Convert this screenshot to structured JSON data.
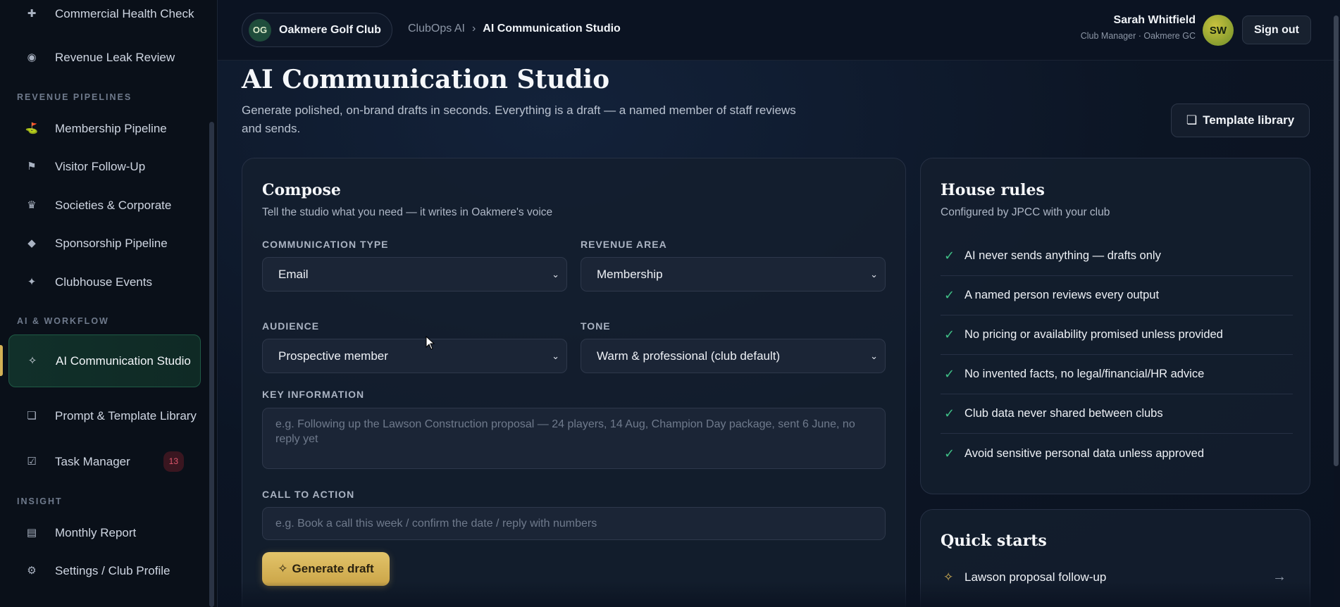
{
  "sidebar": {
    "items": [
      {
        "label": "Commercial Health Check",
        "icon": "plus-icon"
      },
      {
        "label": "Revenue Leak Review",
        "icon": "target-icon"
      },
      {
        "label": "Membership Pipeline",
        "icon": "golf-flag-icon"
      },
      {
        "label": "Visitor Follow-Up",
        "icon": "flag-icon"
      },
      {
        "label": "Societies & Corporate",
        "icon": "crown-icon"
      },
      {
        "label": "Sponsorship Pipeline",
        "icon": "diamond-icon"
      },
      {
        "label": "Clubhouse Events",
        "icon": "sparkle-icon"
      },
      {
        "label": "AI Communication Studio",
        "icon": "sparkle-icon"
      },
      {
        "label": "Prompt & Template Library",
        "icon": "template-icon"
      },
      {
        "label": "Task Manager",
        "icon": "checkbox-icon",
        "badge": "13"
      },
      {
        "label": "Monthly Report",
        "icon": "report-icon"
      },
      {
        "label": "Settings / Club Profile",
        "icon": "gear-icon"
      }
    ],
    "sections": {
      "revenue": "REVENUE PIPELINES",
      "ai": "AI & WORKFLOW",
      "insight": "INSIGHT"
    }
  },
  "topbar": {
    "club_initials": "OG",
    "club_name": "Oakmere Golf Club",
    "breadcrumb_root": "ClubOps AI",
    "breadcrumb_sep": "›",
    "breadcrumb_current": "AI Communication Studio",
    "user_name": "Sarah Whitfield",
    "user_role": "Club Manager · Oakmere GC",
    "user_initials": "SW",
    "signout_label": "Sign out"
  },
  "page": {
    "title": "AI Communication Studio",
    "subtitle": "Generate polished, on-brand drafts in seconds. Everything is a draft — a named member of staff reviews and sends.",
    "template_button": "Template library"
  },
  "compose": {
    "title": "Compose",
    "subtitle": "Tell the studio what you need — it writes in Oakmere's voice",
    "comm_type_label": "COMMUNICATION TYPE",
    "comm_type_value": "Email",
    "revenue_area_label": "REVENUE AREA",
    "revenue_area_value": "Membership",
    "audience_label": "AUDIENCE",
    "audience_value": "Prospective member",
    "tone_label": "TONE",
    "tone_value": "Warm & professional (club default)",
    "key_info_label": "KEY INFORMATION",
    "key_info_placeholder": "e.g. Following up the Lawson Construction proposal — 24 players, 14 Aug, Champion Day package, sent 6 June, no reply yet",
    "cta_label": "CALL TO ACTION",
    "cta_placeholder": "e.g. Book a call this week / confirm the date / reply with numbers",
    "generate_label": "Generate draft"
  },
  "house_rules": {
    "title": "House rules",
    "subtitle": "Configured by JPCC with your club",
    "rules": [
      "AI never sends anything — drafts only",
      "A named person reviews every output",
      "No pricing or availability promised unless provided",
      "No invented facts, no legal/financial/HR advice",
      "Club data never shared between clubs",
      "Avoid sensitive personal data unless approved"
    ]
  },
  "quick_starts": {
    "title": "Quick starts",
    "items": [
      "Lawson proposal follow-up"
    ]
  },
  "colors": {
    "accent_gold": "#d4b155",
    "check_green": "#3fbf86",
    "badge_red": "#e0576d"
  }
}
